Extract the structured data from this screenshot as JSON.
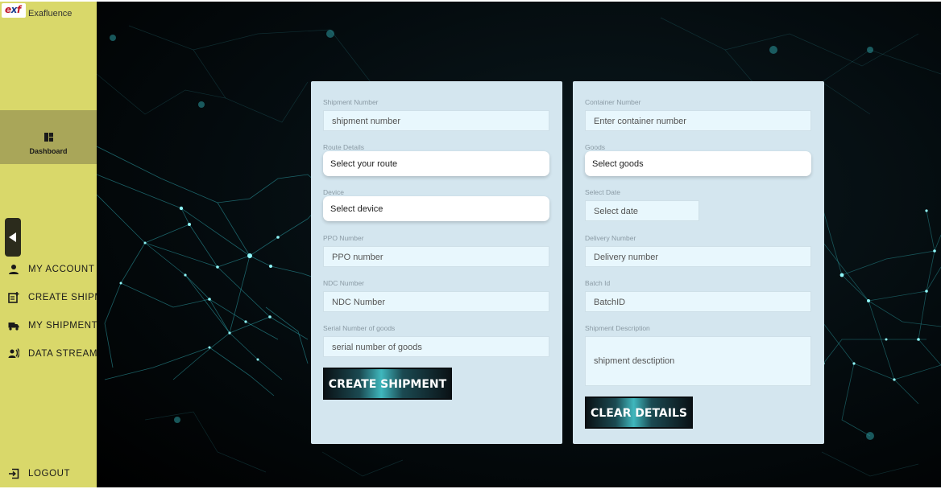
{
  "sidebar": {
    "logo_text_a": "e",
    "logo_text_b": "x",
    "logo_text_c": "f",
    "brand": "Exafluence",
    "dashboard_label": "Dashboard",
    "items": [
      {
        "label": "MY ACCOUNT",
        "icon": "person-icon"
      },
      {
        "label": "CREATE SHIPMENT",
        "icon": "note-add-icon"
      },
      {
        "label": "MY SHIPMENT",
        "icon": "truck-icon"
      },
      {
        "label": "DATA STREAMING",
        "icon": "streaming-icon"
      }
    ],
    "logout_label": "LOGOUT"
  },
  "left_form": {
    "shipment_number": {
      "label": "Shipment Number",
      "placeholder": "shipment number"
    },
    "route": {
      "label": "Route Details",
      "value": "Select your route"
    },
    "device": {
      "label": "Device",
      "value": "Select device"
    },
    "ppo": {
      "label": "PPO Number",
      "placeholder": "PPO number"
    },
    "ndc": {
      "label": "NDC Number",
      "placeholder": "NDC Number"
    },
    "serial": {
      "label": "Serial Number of goods",
      "placeholder": "serial number of goods"
    },
    "create_button": "CREATE SHIPMENT"
  },
  "right_form": {
    "container": {
      "label": "Container Number",
      "placeholder": "Enter container number"
    },
    "goods": {
      "label": "Goods",
      "value": "Select goods"
    },
    "date": {
      "label": "Select Date",
      "placeholder": "Select date"
    },
    "delivery": {
      "label": "Delivery Number",
      "placeholder": "Delivery number"
    },
    "batch": {
      "label": "Batch Id",
      "placeholder": "BatchID"
    },
    "description": {
      "label": "Shipment Description",
      "placeholder": "shipment desctiption"
    },
    "clear_button": "CLEAR DETAILS"
  },
  "colors": {
    "sidebar": "#d9d86a",
    "sidebar_active": "#a9a659",
    "card": "#d4e6ef",
    "input": "#e8f7fd",
    "network": "#2fc4c8"
  }
}
